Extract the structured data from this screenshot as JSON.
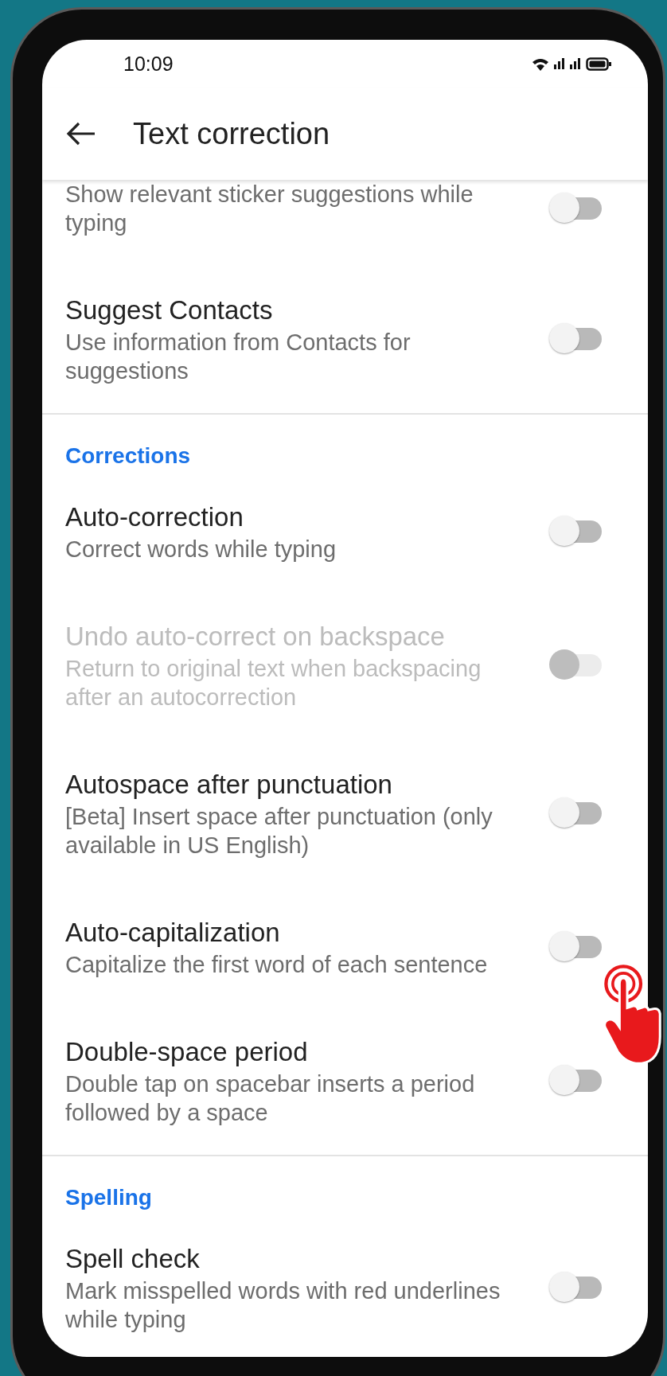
{
  "status_bar": {
    "time": "10:09"
  },
  "header": {
    "title": "Text correction"
  },
  "sections": [
    {
      "items": [
        {
          "subtitle": "Show relevant sticker suggestions while typing",
          "on": false,
          "disabled": false
        },
        {
          "title": "Suggest Contacts",
          "subtitle": "Use information from Contacts for suggestions",
          "on": false,
          "disabled": false
        }
      ]
    },
    {
      "heading": "Corrections",
      "items": [
        {
          "title": "Auto-correction",
          "subtitle": "Correct words while typing",
          "on": false,
          "disabled": false
        },
        {
          "title": "Undo auto-correct on backspace",
          "subtitle": "Return to original text when backspacing after an autocorrection",
          "on": false,
          "disabled": true
        },
        {
          "title": "Autospace after punctuation",
          "subtitle": "[Beta] Insert space after punctuation (only available in US English)",
          "on": false,
          "disabled": false
        },
        {
          "title": "Auto-capitalization",
          "subtitle": "Capitalize the first word of each sentence",
          "on": false,
          "disabled": false
        },
        {
          "title": "Double-space period",
          "subtitle": "Double tap on spacebar inserts a period followed by a space",
          "on": false,
          "disabled": false
        }
      ]
    },
    {
      "heading": "Spelling",
      "items": [
        {
          "title": "Spell check",
          "subtitle": "Mark misspelled words with red underlines while typing",
          "on": false,
          "disabled": false
        }
      ]
    }
  ]
}
